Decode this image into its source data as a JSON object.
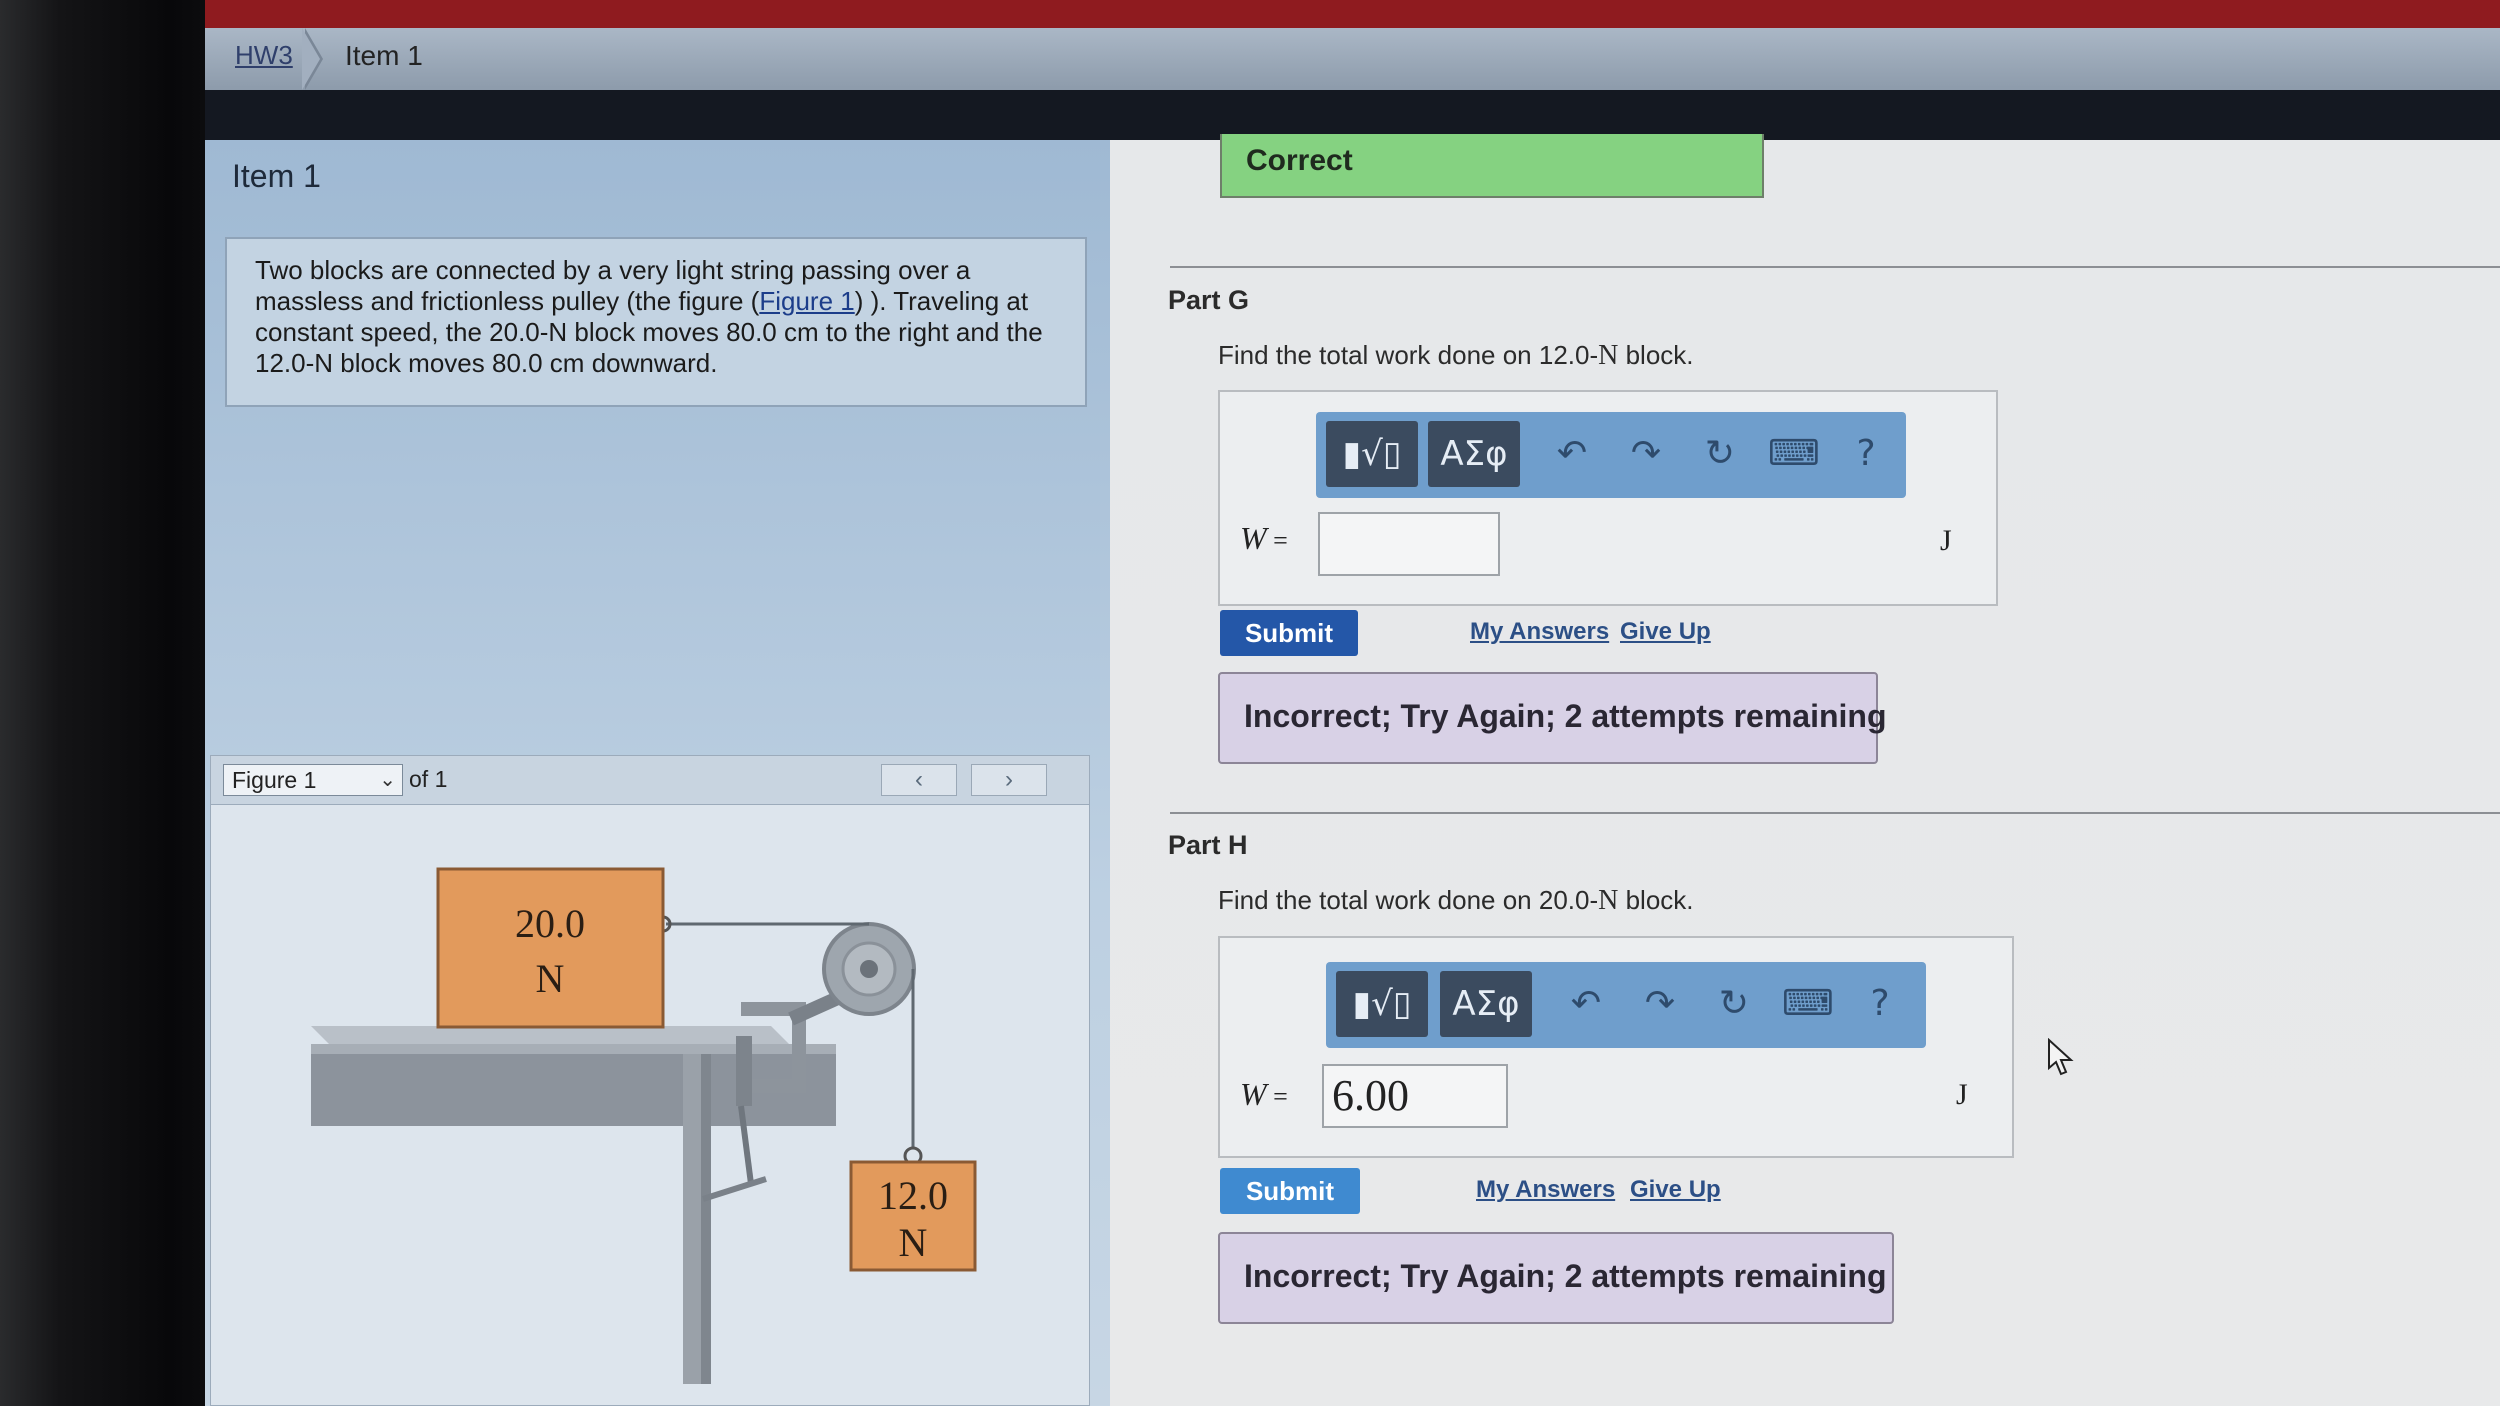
{
  "topbar": {
    "text": ""
  },
  "breadcrumb": {
    "parent": "HW3",
    "current": "Item 1"
  },
  "item": {
    "title": "Item 1",
    "problem_pre": "Two blocks are connected by a very light string passing over a massless and frictionless pulley (the figure (",
    "figure_link": "Figure 1",
    "problem_post": ") ). Traveling at constant speed, the 20.0-N block moves 80.0 cm to the right and the 12.0-N block moves 80.0 cm downward."
  },
  "figure": {
    "select_value": "Figure 1",
    "of_label": "of 1",
    "prev_icon": "‹",
    "next_icon": "›",
    "block_top_line1": "20.0",
    "block_top_line2": "N",
    "block_hang_line1": "12.0",
    "block_hang_line2": "N"
  },
  "status": {
    "correct": "Correct"
  },
  "toolbar": {
    "templates": "▮√▯",
    "symbols": "ΑΣφ",
    "undo": "↶",
    "redo": "↷",
    "reset": "↻",
    "keyboard": "⌨",
    "help": "?"
  },
  "part_g": {
    "heading": "Part G",
    "question_pre": "Find the total work done on 12.0-",
    "question_n": "N",
    "question_post": " block.",
    "var": "W",
    "eq": " =",
    "value": "",
    "unit": "J",
    "submit": "Submit",
    "my_answers": "My Answers",
    "give_up": "Give Up",
    "feedback": "Incorrect; Try Again; 2 attempts remaining"
  },
  "part_h": {
    "heading": "Part H",
    "question_pre": "Find the total work done on 20.0-",
    "question_n": "N",
    "question_post": " block.",
    "var": "W",
    "eq": " =",
    "value": "6.00",
    "unit": "J",
    "submit": "Submit",
    "my_answers": "My Answers",
    "give_up": "Give Up",
    "feedback": "Incorrect; Try Again; 2 attempts remaining"
  },
  "colors": {
    "correct_green": "#85d281",
    "submit_g": "#2457a8",
    "submit_h": "#3f8ad0",
    "toolbar_blue": "#6f9ecc",
    "feedback_bg": "#d8d1e6",
    "block_orange": "#e29a5c"
  }
}
